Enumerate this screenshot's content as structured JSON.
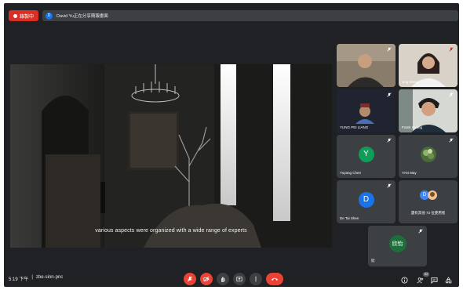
{
  "recording": {
    "label": "錄製中"
  },
  "presenter_banner": {
    "initial": "D",
    "text": "David Yu正在分享簡報畫面"
  },
  "presentation": {
    "caption": "various aspects were organized with a wide range of experts"
  },
  "participants": [
    {
      "name": "",
      "type": "video"
    },
    {
      "name": "Jing Wang",
      "type": "video"
    },
    {
      "name": "YUNG PEI LIANG",
      "type": "video"
    },
    {
      "name": "Frank Huang",
      "type": "video"
    },
    {
      "name": "Yuyang Chen",
      "type": "avatar",
      "initial": "Y",
      "color": "#0f9d58"
    },
    {
      "name": "YAN May",
      "type": "avatar",
      "initial": "",
      "color": "#4a6b3a"
    },
    {
      "name": "De Tai Shen",
      "type": "avatar",
      "initial": "D",
      "color": "#1a73e8"
    },
    {
      "name": "還有其他 73 位使用者",
      "type": "group",
      "initial": "D",
      "color": "#4285f4"
    },
    {
      "name": "欣",
      "type": "avatar",
      "initial": "欣怡",
      "color": "#1e6e3a"
    }
  ],
  "meeting": {
    "time": "5:19 下午",
    "separator": "|",
    "code": "zbe-sinn-pnc"
  },
  "people_count": "52",
  "colors": {
    "background": "#202124",
    "tile": "#3c4043",
    "danger": "#ea4335",
    "accent": "#1a73e8"
  },
  "icons": {
    "controls": [
      "mic-off-icon",
      "camera-off-icon",
      "raise-hand-icon",
      "present-icon",
      "more-options-icon",
      "hang-up-icon"
    ],
    "right": [
      "info-icon",
      "people-icon",
      "chat-icon",
      "activities-icon"
    ]
  }
}
